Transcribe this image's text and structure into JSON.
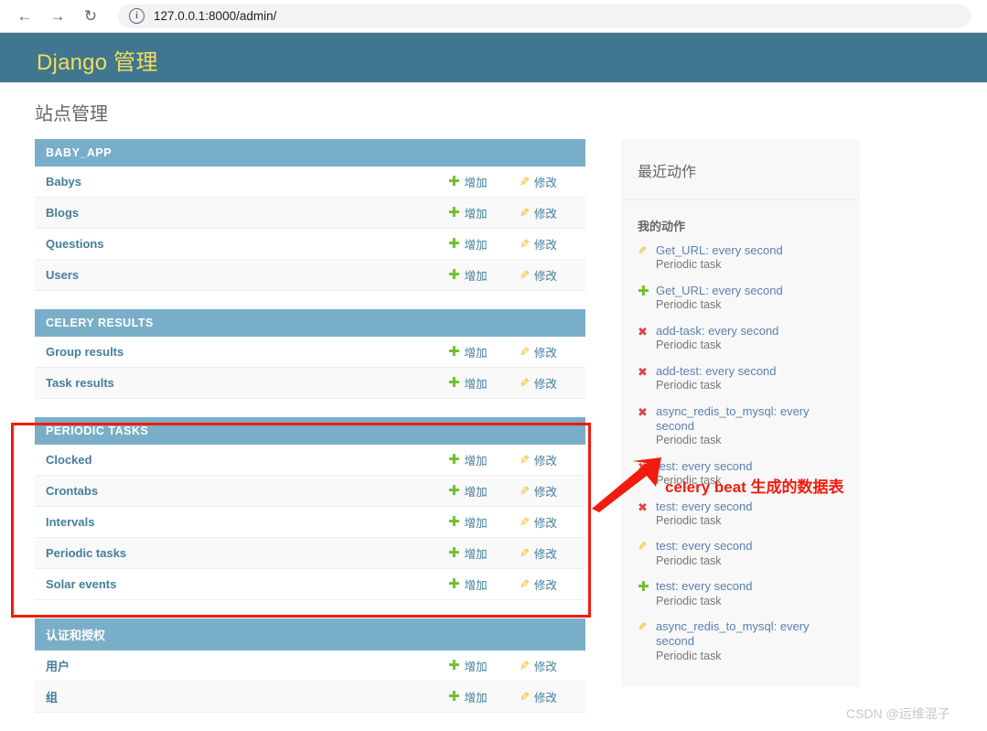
{
  "browser": {
    "back_icon": "arrow-left-icon",
    "forward_icon": "arrow-right-icon",
    "reload_icon": "reload-icon",
    "info_icon": "info-circle-icon",
    "info_glyph": "i",
    "back_glyph": "←",
    "forward_glyph": "→",
    "reload_glyph": "↻",
    "url": "127.0.0.1:8000/admin/"
  },
  "header": {
    "site_title": "Django 管理"
  },
  "page": {
    "title": "站点管理"
  },
  "labels": {
    "add": "增加",
    "change": "修改",
    "plus_glyph": "✚",
    "pencil_glyph": "✎"
  },
  "modules": [
    {
      "caption": "BABY_APP",
      "cjk": false,
      "models": [
        {
          "name": "Babys"
        },
        {
          "name": "Blogs"
        },
        {
          "name": "Questions"
        },
        {
          "name": "Users"
        }
      ]
    },
    {
      "caption": "CELERY RESULTS",
      "cjk": false,
      "models": [
        {
          "name": "Group results"
        },
        {
          "name": "Task results"
        }
      ]
    },
    {
      "caption": "PERIODIC TASKS",
      "cjk": false,
      "models": [
        {
          "name": "Clocked"
        },
        {
          "name": "Crontabs"
        },
        {
          "name": "Intervals"
        },
        {
          "name": "Periodic tasks"
        },
        {
          "name": "Solar events"
        }
      ]
    },
    {
      "caption": "认证和授权",
      "cjk": true,
      "models": [
        {
          "name": "用户"
        },
        {
          "name": "组"
        }
      ]
    }
  ],
  "recent": {
    "heading": "最近动作",
    "subheading": "我的动作",
    "items": [
      {
        "type": "change",
        "title": "Get_URL: every second",
        "meta": "Periodic task"
      },
      {
        "type": "add",
        "title": "Get_URL: every second",
        "meta": "Periodic task"
      },
      {
        "type": "delete",
        "title": "add-task: every second",
        "meta": "Periodic task"
      },
      {
        "type": "delete",
        "title": "add-test: every second",
        "meta": "Periodic task"
      },
      {
        "type": "delete",
        "title": "async_redis_to_mysql: every second",
        "meta": "Periodic task"
      },
      {
        "type": "delete",
        "title": "test: every second",
        "meta": "Periodic task"
      },
      {
        "type": "delete",
        "title": "test: every second",
        "meta": "Periodic task"
      },
      {
        "type": "change",
        "title": "test: every second",
        "meta": "Periodic task"
      },
      {
        "type": "add",
        "title": "test: every second",
        "meta": "Periodic task"
      },
      {
        "type": "change",
        "title": "async_redis_to_mysql: every second",
        "meta": "Periodic task"
      }
    ]
  },
  "annotations": {
    "highlight_color": "#f21b0d",
    "callout_text": "celery beat 生成的数据表"
  },
  "watermark": {
    "text": "CSDN @运维混子"
  }
}
